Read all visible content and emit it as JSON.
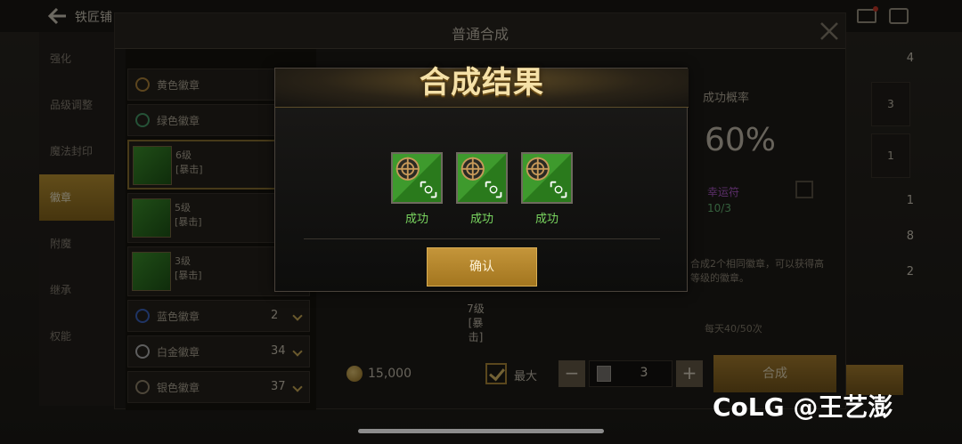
{
  "topbar": {
    "title": "铁匠铺"
  },
  "leftnav": {
    "items": [
      {
        "label": "强化"
      },
      {
        "label": "品级调整"
      },
      {
        "label": "魔法封印"
      },
      {
        "label": "徽章",
        "active": true
      },
      {
        "label": "附魔"
      },
      {
        "label": "继承"
      },
      {
        "label": "权能"
      }
    ]
  },
  "rightcol": {
    "items": [
      "4",
      "3",
      "1",
      "1",
      "8",
      "2"
    ]
  },
  "window": {
    "title": "普通合成",
    "list": {
      "rows_small": [
        {
          "label": "黄色徽章"
        },
        {
          "label": "绿色徽章"
        }
      ],
      "rows_big": [
        {
          "line1": "6级",
          "line2": "[暴击]"
        },
        {
          "line1": "5级",
          "line2": "[暴击]"
        },
        {
          "line1": "3级",
          "line2": "[暴击]"
        }
      ],
      "rows_bottom": [
        {
          "label": "蓝色徽章",
          "count": "2"
        },
        {
          "label": "白金徽章",
          "count": "34"
        },
        {
          "label": "银色徽章",
          "count": "37"
        }
      ]
    },
    "probability": {
      "title": "成功概率",
      "value": "60%"
    },
    "charm": {
      "label": "幸运符",
      "count": "10/3"
    },
    "desc": "合成2个相同徽章，可以获得高等级的徽章。",
    "daily": "每天40/50次",
    "target": {
      "line1": "7级",
      "line2": "[暴击]"
    },
    "cost": "15,000",
    "max_label": "最大",
    "stepper": {
      "minus": "−",
      "plus": "+",
      "value": "3"
    },
    "compose_label": "合成"
  },
  "modal": {
    "title": "合成结果",
    "results": [
      {
        "label": "成功"
      },
      {
        "label": "成功"
      },
      {
        "label": "成功"
      }
    ],
    "confirm_label": "确认"
  },
  "watermark": "CoLG @王艺澎",
  "colors": {
    "accent_gold": "#c4953a",
    "success_green": "#7ad760"
  }
}
